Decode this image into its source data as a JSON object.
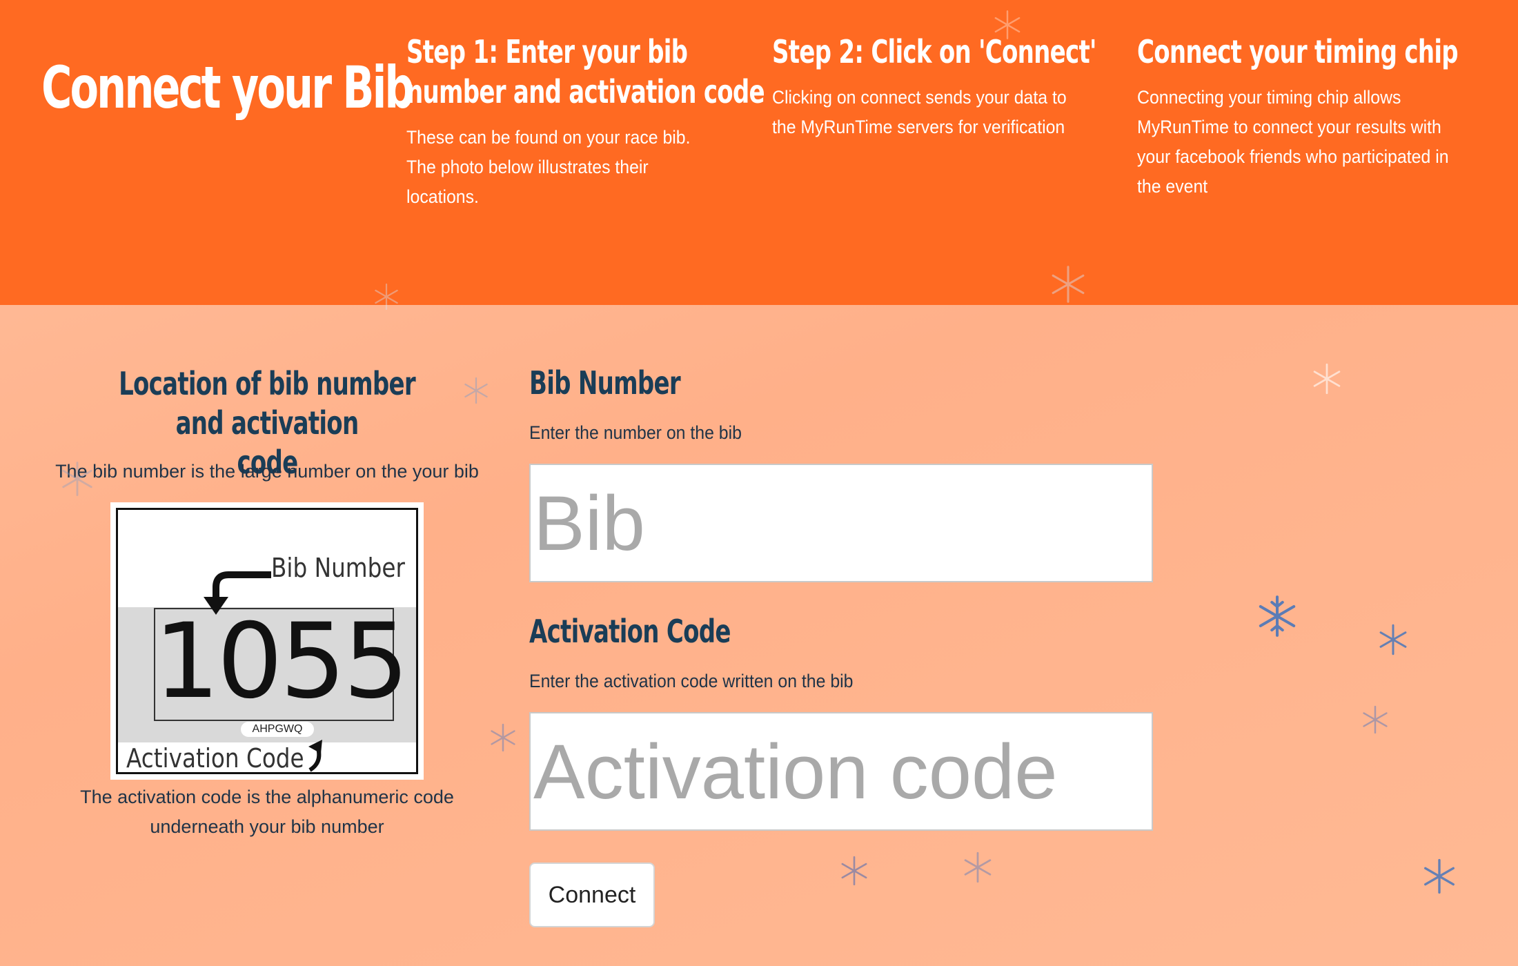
{
  "header": {
    "brand": "Connect your Bib",
    "steps": [
      {
        "title_lines": [
          "Step 1: Enter your bib",
          "number and activation code"
        ],
        "text": "These can be found on your race bib. The photo below illustrates their locations."
      },
      {
        "title_lines": [
          "Step 2: Click on 'Connect'"
        ],
        "text": "Clicking on connect sends your data to the MyRunTime servers for verification"
      },
      {
        "title_lines": [
          "Connect your timing chip"
        ],
        "text": "Connecting your timing chip allows MyRunTime to connect your results with your facebook friends who participated in the event"
      }
    ]
  },
  "location": {
    "title_lines": [
      "Location of bib number and activation",
      "code"
    ],
    "subtitle": "The bib number is the large number on the your bib",
    "photo": {
      "bib_number_label": "Bib Number",
      "bib_number": "1055",
      "activation_code": "AHPGWQ",
      "activation_code_label": "Activation Code"
    },
    "caption_lines": [
      "The activation code is the alphanumeric code",
      "underneath your bib number"
    ]
  },
  "form": {
    "bib": {
      "label": "Bib Number",
      "help": "Enter the number on the bib",
      "placeholder": "Bib",
      "value": ""
    },
    "activation": {
      "label": "Activation Code",
      "help": "Enter the activation code written on the bib",
      "placeholder": "Activation code",
      "value": ""
    },
    "connect_label": "Connect"
  },
  "colors": {
    "header_bg": "#ff6a22",
    "page_bg": "#ffb594",
    "heading_navy": "#1a3d57",
    "snowflake": "#4a7cc2"
  },
  "icons": {
    "decorations": "snowflake-icon",
    "arrows": "curved-arrow-icon"
  }
}
